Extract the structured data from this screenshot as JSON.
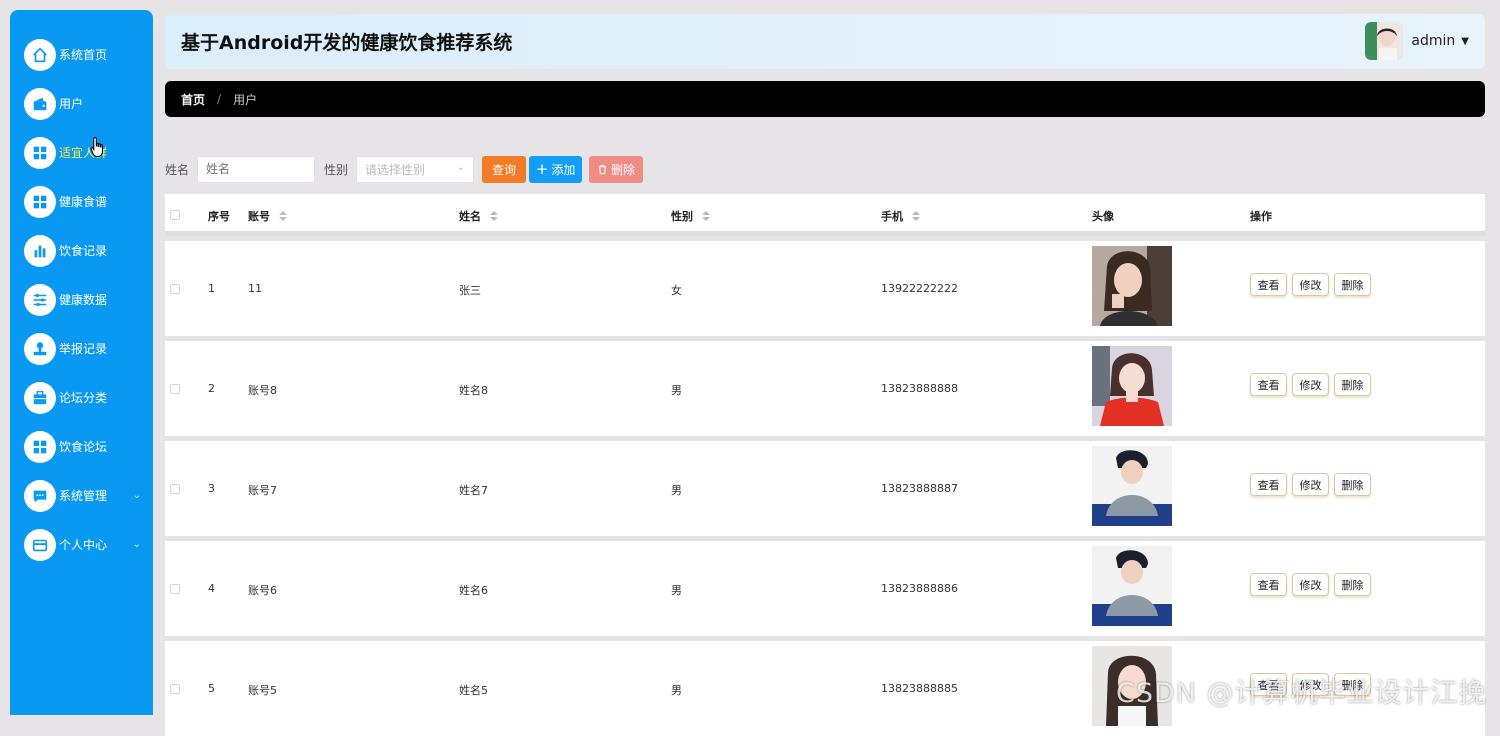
{
  "app": {
    "title": "基于Android开发的健康饮食推荐系统",
    "user": "admin"
  },
  "sidebar": {
    "items": [
      {
        "label": "系统首页",
        "icon": "home-icon"
      },
      {
        "label": "用户",
        "icon": "wallet-icon"
      },
      {
        "label": "适宜人群",
        "icon": "grid-icon"
      },
      {
        "label": "健康食谱",
        "icon": "grid-icon"
      },
      {
        "label": "饮食记录",
        "icon": "bar-chart-icon"
      },
      {
        "label": "健康数据",
        "icon": "sliders-icon"
      },
      {
        "label": "举报记录",
        "icon": "stamp-icon"
      },
      {
        "label": "论坛分类",
        "icon": "briefcase-icon"
      },
      {
        "label": "饮食论坛",
        "icon": "grid-icon"
      },
      {
        "label": "系统管理",
        "icon": "chat-icon"
      },
      {
        "label": "个人中心",
        "icon": "card-icon"
      }
    ]
  },
  "breadcrumb": {
    "home": "首页",
    "separator": "/",
    "current": "用户"
  },
  "search": {
    "name_label": "姓名",
    "name_placeholder": "姓名",
    "gender_label": "性别",
    "gender_placeholder": "请选择性别",
    "query": "查询",
    "add": "添加",
    "delete": "删除"
  },
  "table": {
    "headers": {
      "index": "序号",
      "account": "账号",
      "name": "姓名",
      "gender": "性别",
      "phone": "手机",
      "avatar": "头像",
      "ops": "操作"
    },
    "rows": [
      {
        "index": "1",
        "account": "11",
        "name": "张三",
        "gender": "女",
        "phone": "13922222222"
      },
      {
        "index": "2",
        "account": "账号8",
        "name": "姓名8",
        "gender": "男",
        "phone": "13823888888"
      },
      {
        "index": "3",
        "account": "账号7",
        "name": "姓名7",
        "gender": "男",
        "phone": "13823888887"
      },
      {
        "index": "4",
        "account": "账号6",
        "name": "姓名6",
        "gender": "男",
        "phone": "13823888886"
      },
      {
        "index": "5",
        "account": "账号5",
        "name": "姓名5",
        "gender": "男",
        "phone": "13823888885"
      }
    ],
    "op_view": "查看",
    "op_edit": "修改",
    "op_delete": "删除"
  },
  "watermark": "CSDN @计算机毕业设计江挽",
  "colors": {
    "sidebar": "#0a99f2",
    "query_button": "#f47b25",
    "add_button": "#129ef5",
    "delete_button": "#f08c86",
    "hover_text": "#f5f04a"
  }
}
